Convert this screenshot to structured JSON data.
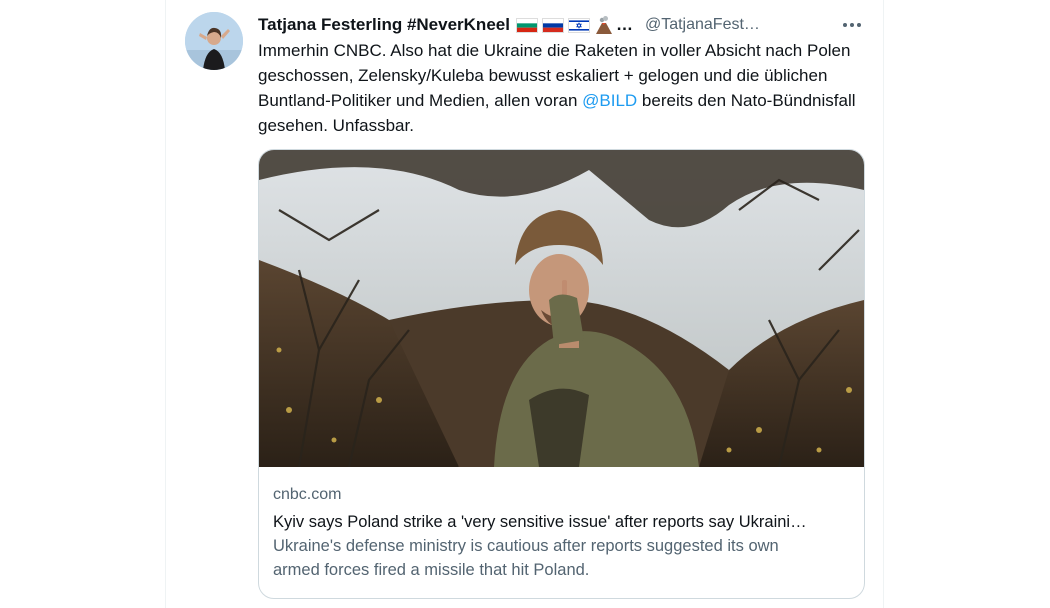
{
  "tweet": {
    "author": {
      "display_name": "Tatjana Festerling #NeverKneel",
      "handle": "@TatjanaFest…",
      "name_ellipsis": "…",
      "flags": [
        "bulgaria-flag",
        "russia-flag",
        "israel-flag",
        "volcano-emoji"
      ]
    },
    "more_icon": "more-horizontal-icon",
    "text": {
      "part1": "Immerhin CNBC. Also hat die Ukraine die Raketen in voller Absicht nach Polen geschossen, Zelensky/Kuleba bewusst eskaliert + gelogen und die üblichen Buntland-Politiker und Medien, allen voran ",
      "mention": "@BILD",
      "part2": " bereits den Nato-Bündnisfall gesehen. Unfassbar."
    },
    "card": {
      "domain": "cnbc.com",
      "title": "Kyiv says Poland strike a 'very sensitive issue' after reports say Ukraini…",
      "description_line1": "Ukraine's defense ministry is cautious after reports suggested its own",
      "description_line2": "armed forces fired a missile that hit Poland."
    }
  },
  "colors": {
    "link": "#1d9bf0",
    "text": "#0f1419",
    "secondary": "#536471",
    "border": "#cfd9de"
  }
}
